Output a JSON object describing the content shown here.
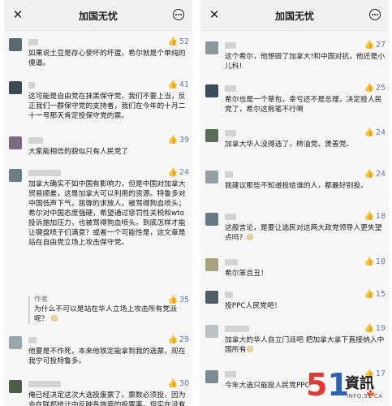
{
  "app": {
    "title": "加国无忧"
  },
  "left": {
    "comments": [
      {
        "likes": "52",
        "text": "如果说土豆是存心使坏的坏蛋，希尔就是个单纯的傻逼。"
      },
      {
        "likes": "41",
        "text": "这可能是自由党在抹黑保守党，我们不要上当，反正我们一群保守党的支持者，我们在今年的十月二十一号那天肯定投保守党的票。"
      },
      {
        "likes": "39",
        "text": "大家能相信的貌似只有人民党了"
      },
      {
        "likes": "24",
        "text": "加拿大确实不如中国有影响力，但是中国对加拿大贸易顺差，这是加拿大可以利用的资源。特鲁多对中国低声下气，屈辱的求放人，被骂得狗血喷头；希尔对中国态度强硬，希望通过惩罚性关税和wto投诉施加压力，也被骂得狗血喷头。到底怎样才能让键盘喷子们满意？或者一个可能性是，这文章是站在自由党立场上攻击保守党。",
        "author_tag": "作者",
        "author_reply": "为什么不可以是站在华人立场上攻击所有党派呢？",
        "author_emoji": "😄",
        "author_likes": "35"
      },
      {
        "likes": "29",
        "text": "他要是不作死，本来他铁定能拿到我的选票，现在我宁可投特鲁多。"
      },
      {
        "likes": "30",
        "text": "俺已经决定这次大选投废票了。票数必须投，因为会在联邦统计中反映各族裔的投票率，但实在没有一个政党值得投票"
      }
    ]
  },
  "right": {
    "comments": [
      {
        "likes": "27",
        "text": "这个希尔，他想毁了加拿大!和中国对抗，他还是小儿科!"
      },
      {
        "likes": "25",
        "text": "希尔也是一个草包，幸亏还不是总理，决定投人民党了，希尔这熊笔不行啊"
      },
      {
        "likes": "24",
        "text": "加拿大华人没得选了，柿油党、煲善党、"
      },
      {
        "likes": "24",
        "text": "我建议那些不知道投给谁的人，都最好别投。"
      },
      {
        "likes": "18",
        "text": "这般言论，是要让选民对这两大政党领导人更失望点吗？",
        "emoji": "😄"
      },
      {
        "likes": "18",
        "text": "希尔笨且丑！"
      },
      {
        "likes": "15",
        "text": "投PPC人民党吧！"
      },
      {
        "likes": "19",
        "text": "加拿大的华人自立门派吧 把加拿大拿下直接纳入中国所有",
        "emoji": "😄"
      },
      {
        "likes": "17",
        "text": "今年大选只能投人民党PPC"
      }
    ]
  },
  "logo": {
    "number_5": "5",
    "number_1": "1",
    "chinese": "資訊",
    "site": "INFO.51.CA"
  },
  "colors": {
    "likes": "#5f77a8",
    "avatar": "#5a6a74",
    "logo_red": "#e8372f",
    "logo_blue": "#2a62b8"
  }
}
